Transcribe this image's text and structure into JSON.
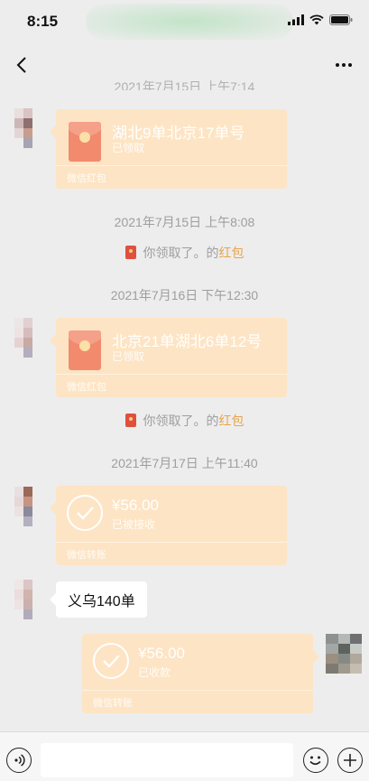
{
  "status_bar": {
    "time": "8:15"
  },
  "chat": {
    "cut_off_time": "2021年7月15日 上午7:14",
    "messages": [
      {
        "type": "red_packet",
        "side": "left",
        "title": "湖北9单北京17单号",
        "status": "已领取",
        "footer": "微信红包"
      },
      {
        "type": "time",
        "text": "2021年7月15日 上午8:08"
      },
      {
        "type": "notice",
        "prefix": "你领取了",
        "middle": "。的",
        "link": "红包"
      },
      {
        "type": "time",
        "text": "2021年7月16日 下午12:30"
      },
      {
        "type": "red_packet",
        "side": "left",
        "title": "北京21单湖北6单12号",
        "status": "已领取",
        "footer": "微信红包"
      },
      {
        "type": "notice",
        "prefix": "你领取了",
        "middle": "。的",
        "link": "红包"
      },
      {
        "type": "time",
        "text": "2021年7月17日 上午11:40"
      },
      {
        "type": "transfer",
        "side": "left",
        "amount": "¥56.00",
        "status": "已被接收",
        "footer": "微信转账"
      },
      {
        "type": "text",
        "side": "left",
        "text": "义乌140单"
      },
      {
        "type": "transfer",
        "side": "right",
        "amount": "¥56.00",
        "status": "已收款",
        "footer": "微信转账"
      }
    ]
  },
  "colors": {
    "card": "#fde4c4",
    "link": "#e8a44a",
    "background": "#ededed"
  },
  "icons": {
    "back": "back-arrow-icon",
    "more": "more-dots-icon",
    "voice": "voice-icon",
    "emoji": "emoji-icon",
    "plus": "plus-icon",
    "red_packet": "red-packet-icon",
    "transfer": "transfer-check-icon"
  }
}
